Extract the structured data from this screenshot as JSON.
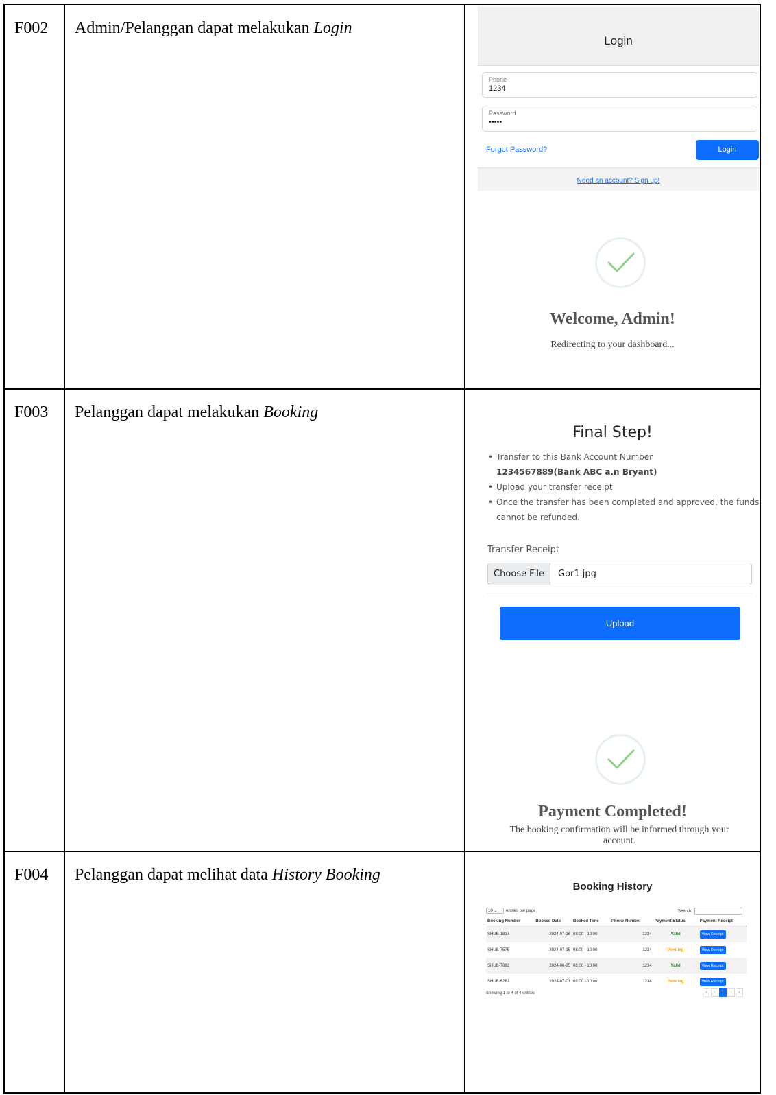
{
  "rows": [
    {
      "id": "F002",
      "desc_plain": "Admin/Pelanggan dapat melakukan ",
      "desc_italic": "Login"
    },
    {
      "id": "F003",
      "desc_plain": "Pelanggan dapat melakukan ",
      "desc_italic": "Booking"
    },
    {
      "id": "F004",
      "desc_plain": "Pelanggan dapat melihat data ",
      "desc_italic": "History Booking"
    }
  ],
  "login": {
    "title": "Login",
    "phone_label": "Phone",
    "phone_value": "1234",
    "password_label": "Password",
    "password_value": "•••••",
    "forgot": "Forgot Password?",
    "button": "Login",
    "signup": "Need an account? Sign up!"
  },
  "welcome": {
    "title": "Welcome, Admin!",
    "subtitle": "Redirecting to your dashboard..."
  },
  "final_step": {
    "title": "Final Step!",
    "item1": "Transfer to this Bank Account Number",
    "account": "1234567889(Bank ABC a.n Bryant)",
    "item2": "Upload your transfer receipt",
    "item3": "Once the transfer has been completed and approved, the funds cannot be refunded.",
    "receipt_label": "Transfer Receipt",
    "choose_file": "Choose File",
    "file_name": "Gor1.jpg",
    "upload": "Upload"
  },
  "payment": {
    "title": "Payment Completed!",
    "subtitle": "The booking confirmation will be informed through your account."
  },
  "history": {
    "title": "Booking History",
    "entries_value": "10",
    "entries_label": "entries per page",
    "search_label": "Search:",
    "columns": [
      "Booking Number",
      "Booked Date",
      "Booked Time",
      "Phone Number",
      "Payment Status",
      "Payment Receipt"
    ],
    "rows": [
      [
        "SHUB-1817",
        "2024-07-16",
        "08:00 - 10:00",
        "1234",
        "Valid",
        "View Receipt"
      ],
      [
        "SHUB-7575",
        "2024-07-15",
        "08:00 - 10:00",
        "1234",
        "Pending",
        "View Receipt"
      ],
      [
        "SHUB-7882",
        "2024-06-25",
        "08:00 - 10:00",
        "1234",
        "Valid",
        "View Receipt"
      ],
      [
        "SHUB-8262",
        "2024-07-01",
        "08:00 - 10:00",
        "1234",
        "Pending",
        "View Receipt"
      ]
    ],
    "info": "Showing 1 to 4 of 4 entries",
    "pager": [
      "«",
      "‹",
      "1",
      "›",
      "»"
    ]
  }
}
